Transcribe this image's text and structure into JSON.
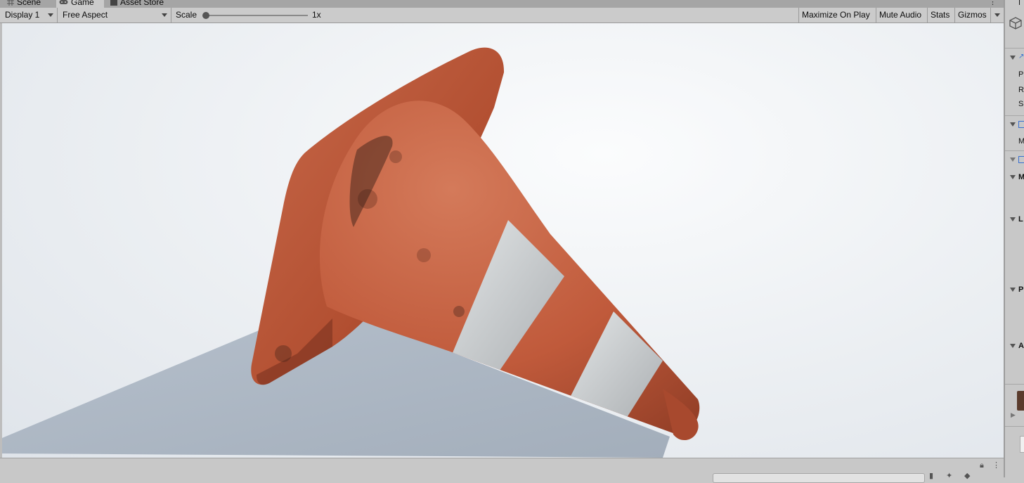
{
  "tabs": [
    {
      "label": "Scene",
      "icon": "scene-grid-icon",
      "active": false
    },
    {
      "label": "Game",
      "icon": "game-controller-icon",
      "active": true
    },
    {
      "label": "Asset Store",
      "icon": "asset-store-icon",
      "active": false
    }
  ],
  "toolbar": {
    "display": "Display 1",
    "aspect": "Free Aspect",
    "scale_label": "Scale",
    "scale_value": "1x",
    "scale_slider_fraction": 0.0,
    "maximize_on_play": "Maximize On Play",
    "mute_audio": "Mute Audio",
    "stats": "Stats",
    "gizmos": "Gizmos"
  },
  "scene": {
    "object": "traffic-cone",
    "cone_color": "#c25c3a",
    "stripe_color": "#d2d6d8",
    "shadow_color": "#a9b3bf",
    "background_color": "#eef1f4"
  },
  "inspector": {
    "rows": [
      {
        "letter": "P",
        "bold": false
      },
      {
        "letter": "R",
        "bold": false
      },
      {
        "letter": "S",
        "bold": false
      },
      {
        "letter": "M",
        "bold": false
      },
      {
        "letter": "M",
        "bold": true
      },
      {
        "letter": "L",
        "bold": true
      },
      {
        "letter": "P",
        "bold": true
      },
      {
        "letter": "A",
        "bold": true
      }
    ],
    "header_letter": "I"
  }
}
